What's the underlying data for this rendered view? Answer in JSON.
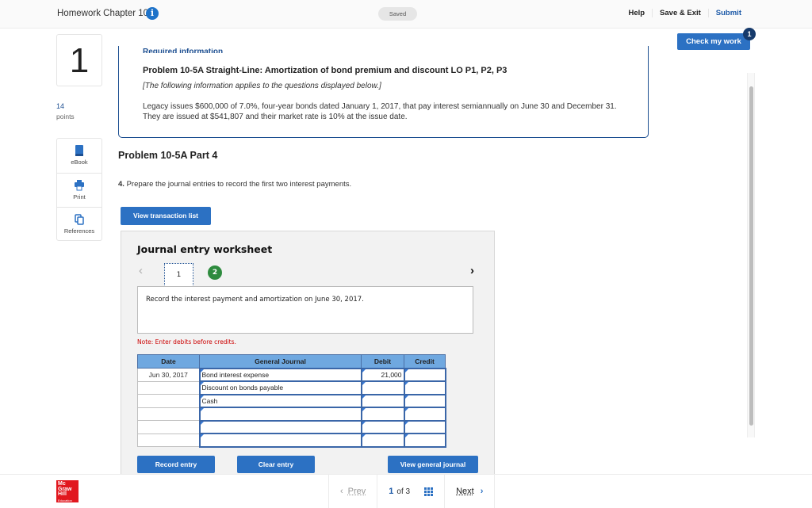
{
  "header": {
    "title": "Homework Chapter 10",
    "info_icon": "info-icon",
    "status": "Saved",
    "links": {
      "help": "Help",
      "save_exit": "Save & Exit",
      "submit": "Submit"
    },
    "check_my_work": {
      "label": "Check my work",
      "badge": "1"
    }
  },
  "question": {
    "number": "1",
    "points_value": "14",
    "points_label": "points"
  },
  "tools": [
    {
      "icon": "book-icon",
      "label": "eBook"
    },
    {
      "icon": "printer-icon",
      "label": "Print"
    },
    {
      "icon": "references-icon",
      "label": "References"
    }
  ],
  "info_box": {
    "heading": "Required information",
    "title": "Problem 10-5A Straight-Line: Amortization of bond premium and discount LO P1, P2, P3",
    "note": "[The following information applies to the questions displayed below.]",
    "body": "Legacy issues $600,000 of 7.0%, four-year bonds dated January 1, 2017, that pay interest semiannually on June 30 and December 31. They are issued at $541,807 and their market rate is 10% at the issue date."
  },
  "part": {
    "title": "Problem 10-5A Part 4",
    "question_number": "4.",
    "question_text": " Prepare the journal entries to record the first two interest payments.",
    "view_transaction_list": "View transaction list"
  },
  "worksheet": {
    "title": "Journal entry worksheet",
    "tabs": [
      "1",
      "2"
    ],
    "active_tab": "1",
    "description": "Record the interest payment and amortization on June 30, 2017.",
    "note": "Note: Enter debits before credits.",
    "columns": [
      "Date",
      "General Journal",
      "Debit",
      "Credit"
    ],
    "rows": [
      {
        "date": "Jun 30, 2017",
        "account": "Bond interest expense",
        "debit": "21,000",
        "credit": ""
      },
      {
        "date": "",
        "account": "Discount on bonds payable",
        "debit": "",
        "credit": ""
      },
      {
        "date": "",
        "account": "Cash",
        "debit": "",
        "credit": ""
      },
      {
        "date": "",
        "account": "",
        "debit": "",
        "credit": ""
      },
      {
        "date": "",
        "account": "",
        "debit": "",
        "credit": ""
      },
      {
        "date": "",
        "account": "",
        "debit": "",
        "credit": ""
      }
    ],
    "buttons": {
      "record": "Record entry",
      "clear": "Clear entry",
      "view_journal": "View general journal"
    }
  },
  "footer": {
    "logo": {
      "line1": "Mc",
      "line2": "Graw",
      "line3": "Hill",
      "line4": "Education"
    },
    "prev": "Prev",
    "current_page": "1",
    "of_label": "of 3",
    "next": "Next"
  },
  "colors": {
    "accent": "#2c71c3",
    "brand_navy": "#1d4f91",
    "note_red": "#cc0000",
    "tab_green": "#2e8b3e",
    "logo_red": "#e1171e"
  }
}
